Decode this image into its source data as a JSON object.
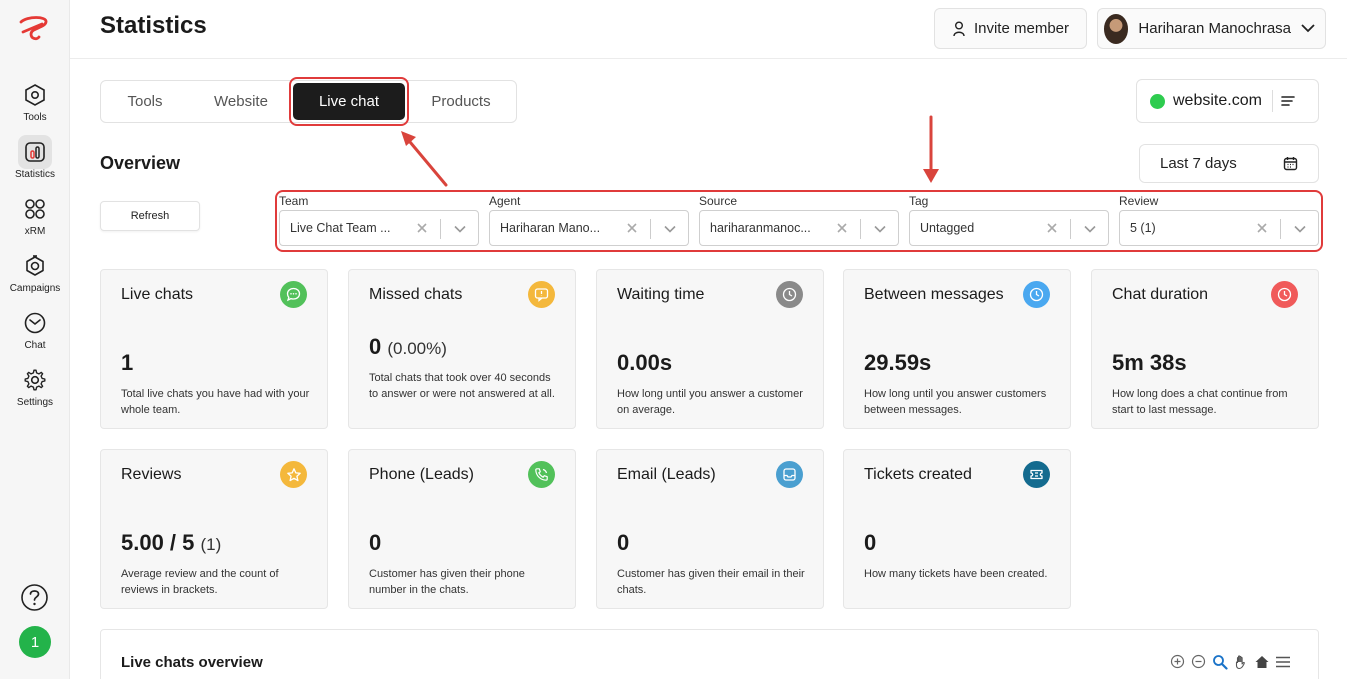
{
  "header": {
    "title": "Statistics",
    "invite_label": "Invite member",
    "user_name": "Hariharan Manochrasa"
  },
  "sidebar": {
    "items": [
      {
        "label": "Tools",
        "icon": "hexagon-icon"
      },
      {
        "label": "Statistics",
        "icon": "bar-chart-icon",
        "active": true
      },
      {
        "label": "xRM",
        "icon": "grid-icon"
      },
      {
        "label": "Campaigns",
        "icon": "megaphone-icon"
      },
      {
        "label": "Chat",
        "icon": "chat-icon"
      },
      {
        "label": "Settings",
        "icon": "gear-icon"
      }
    ],
    "user_badge": "1"
  },
  "tabs": [
    {
      "label": "Tools"
    },
    {
      "label": "Website"
    },
    {
      "label": "Live chat",
      "active": true
    },
    {
      "label": "Products"
    }
  ],
  "site_selector": {
    "label": "website.com",
    "status_color": "#2ecc4f"
  },
  "overview": {
    "title": "Overview",
    "date_range": "Last 7 days",
    "refresh_label": "Refresh"
  },
  "filters": [
    {
      "label": "Team",
      "value": "Live Chat Team ..."
    },
    {
      "label": "Agent",
      "value": "Hariharan Mano..."
    },
    {
      "label": "Source",
      "value": "hariharanmanoc..."
    },
    {
      "label": "Tag",
      "value": "Untagged"
    },
    {
      "label": "Review",
      "value": "5 (1)"
    }
  ],
  "cards": [
    {
      "title": "Live chats",
      "value": "1",
      "sub": "",
      "desc": "Total live chats you have had with your whole team.",
      "icon": "chat-bubble-icon",
      "color": "#52c15a"
    },
    {
      "title": "Missed chats",
      "value": "0",
      "sub": "(0.00%)",
      "desc": "Total chats that took over 40 seconds to answer or were not answered at all.",
      "icon": "missed-chat-icon",
      "color": "#f4b83c"
    },
    {
      "title": "Waiting time",
      "value": "0.00s",
      "sub": "",
      "desc": "How long until you answer a customer on average.",
      "icon": "clock-icon",
      "color": "#8a8a8a"
    },
    {
      "title": "Between messages",
      "value": "29.59s",
      "sub": "",
      "desc": "How long until you answer customers between messages.",
      "icon": "clock-icon",
      "color": "#4aa8f0"
    },
    {
      "title": "Chat duration",
      "value": "5m 38s",
      "sub": "",
      "desc": "How long does a chat continue from start to last message.",
      "icon": "clock-icon",
      "color": "#f05a5a"
    },
    {
      "title": "Reviews",
      "value": "5.00 / 5",
      "sub": "(1)",
      "desc": "Average review and the count of reviews in brackets.",
      "icon": "star-icon",
      "color": "#f4b83c"
    },
    {
      "title": "Phone (Leads)",
      "value": "0",
      "sub": "",
      "desc": "Customer has given their phone number in the chats.",
      "icon": "phone-icon",
      "color": "#52c15a"
    },
    {
      "title": "Email (Leads)",
      "value": "0",
      "sub": "",
      "desc": "Customer has given their email in their chats.",
      "icon": "inbox-icon",
      "color": "#4a9fd0"
    },
    {
      "title": "Tickets created",
      "value": "0",
      "sub": "",
      "desc": "How many tickets have been created.",
      "icon": "ticket-icon",
      "color": "#146b8f"
    }
  ],
  "bottom": {
    "title": "Live chats overview"
  }
}
